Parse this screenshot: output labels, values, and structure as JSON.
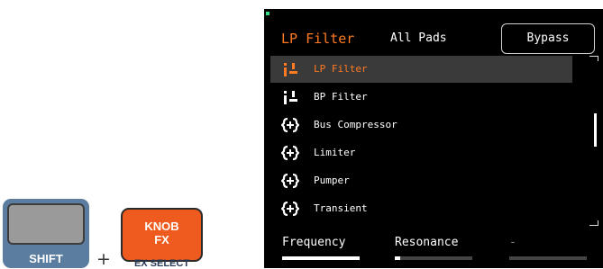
{
  "hardware": {
    "shift_label": "SHIFT",
    "plus_symbol": "+",
    "knob_fx_line1": "KNOB",
    "knob_fx_line2": "FX",
    "fx_select_label": "EX SELECT"
  },
  "screen": {
    "title": "LP Filter",
    "scope": "All Pads",
    "bypass_label": "Bypass",
    "effects": [
      {
        "label": "LP Filter",
        "icon": "filter-icon",
        "selected": true
      },
      {
        "label": "BP Filter",
        "icon": "filter-icon",
        "selected": false
      },
      {
        "label": "Bus Compressor",
        "icon": "dynamics-icon",
        "selected": false
      },
      {
        "label": "Limiter",
        "icon": "dynamics-icon",
        "selected": false
      },
      {
        "label": "Pumper",
        "icon": "dynamics-icon",
        "selected": false
      },
      {
        "label": "Transient",
        "icon": "dynamics-icon",
        "selected": false
      }
    ],
    "params": [
      {
        "label": "Frequency",
        "level": 1.0
      },
      {
        "label": "Resonance",
        "level": 0.07
      },
      {
        "label": "-",
        "level": 0
      }
    ]
  },
  "colors": {
    "accent": "#ff7a21",
    "led": "#37e08c",
    "shift_button": "#5a7da0",
    "fx_button": "#ef5a1e"
  }
}
